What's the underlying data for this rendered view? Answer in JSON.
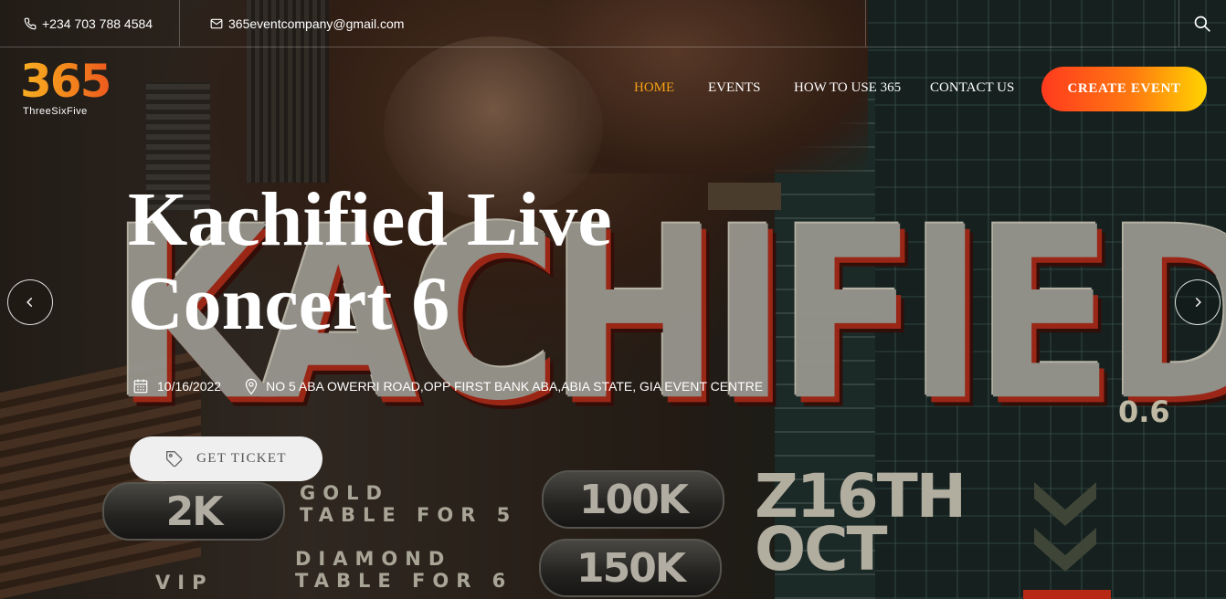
{
  "topbar": {
    "phone": "+234 703 788 4584",
    "email": "365eventcompany@gmail.com",
    "phone_icon": "phone-icon",
    "email_icon": "mail-icon",
    "search_icon": "search-icon"
  },
  "logo": {
    "number": "365",
    "tagline": "ThreeSixFive"
  },
  "nav": {
    "items": [
      {
        "label": "HOME",
        "active": true
      },
      {
        "label": "EVENTS",
        "active": false
      },
      {
        "label": "HOW TO USE 365",
        "active": false
      },
      {
        "label": "CONTACT US",
        "active": false
      }
    ],
    "cta_label": "CREATE EVENT"
  },
  "slide": {
    "title": "Kachified Live Concert 6",
    "date": "10/16/2022",
    "location": "NO 5 ABA OWERRI ROAD,OPP FIRST BANK ABA,ABIA STATE, GIA EVENT CENTRE",
    "date_icon": "calendar-icon",
    "location_icon": "map-pin-icon",
    "ticket_label": "GET TICKET",
    "ticket_icon": "tag-icon",
    "prev_icon": "chevron-left-icon",
    "next_icon": "chevron-right-icon"
  },
  "poster": {
    "headline": "KACHIFIED",
    "version": "0.6",
    "price_regular": "2K",
    "price_vip_label": "VIP",
    "gold_label_line1": "GOLD",
    "gold_label_line2": "TABLE FOR 5",
    "gold_price": "100K",
    "diamond_label_line1": "DIAMOND",
    "diamond_label_line2": "TABLE FOR 6",
    "diamond_price": "150K",
    "date_line1": "Z16TH",
    "date_line2": "OCT"
  },
  "colors": {
    "accent": "#f4a014",
    "cta_start": "#ff3a1e",
    "cta_end": "#ffd400",
    "ticket_bg": "#efefef"
  }
}
